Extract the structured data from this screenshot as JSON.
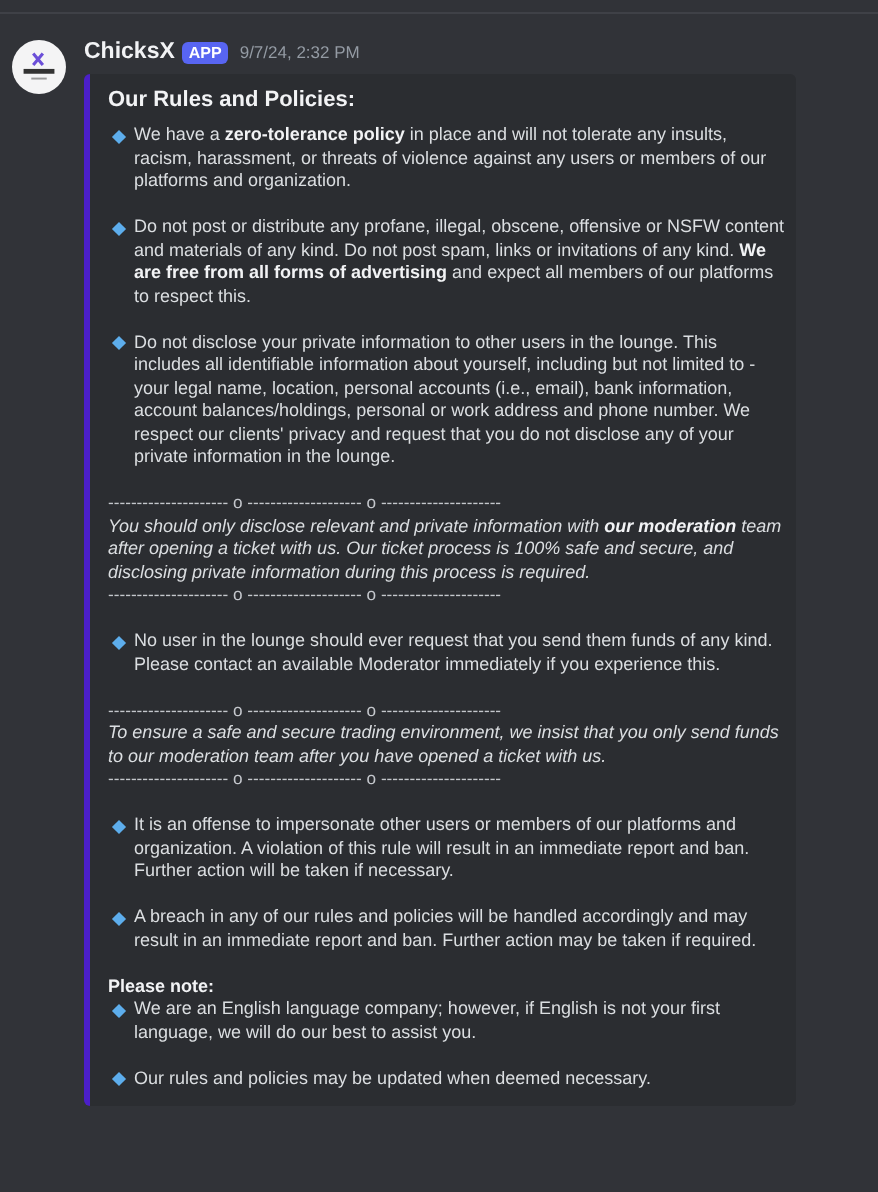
{
  "message": {
    "author": "ChicksX",
    "badge": "APP",
    "timestamp": "9/7/24, 2:32 PM"
  },
  "embed": {
    "color": "#4b1fc9",
    "blocks": [
      {
        "kind": "title",
        "spaced": false,
        "text": "Our Rules and Policies:"
      },
      {
        "kind": "bullet",
        "spaced": false,
        "text": "We have a **zero-tolerance policy** in place and will not tolerate any insults, racism, harassment, or threats of violence against any users or members of our platforms and organization."
      },
      {
        "kind": "bullet",
        "spaced": true,
        "text": "Do not post or distribute any profane, illegal, obscene, offensive or NSFW content and materials of any kind. Do not post spam, links or invitations of any kind. **We are free from all forms of advertising** and expect all members of our platforms to respect this."
      },
      {
        "kind": "bullet",
        "spaced": true,
        "text": "Do not disclose your private information to other users in the lounge. This includes all identifiable information about yourself, including but not limited to - your legal name, location, personal accounts (i.e., email), bank information, account balances/holdings, personal or work address and phone number. We respect our clients' privacy and request that you do not disclose any of your private information in the lounge."
      },
      {
        "kind": "rule",
        "spaced": true,
        "text": "--------------------- o -------------------- o ---------------------"
      },
      {
        "kind": "italic",
        "spaced": false,
        "text": "You should only disclose relevant and private information with **our moderation** team after opening a ticket with us. Our ticket process is 100% safe and secure, and disclosing private information during this process is required."
      },
      {
        "kind": "rule",
        "spaced": false,
        "text": "--------------------- o -------------------- o ---------------------"
      },
      {
        "kind": "bullet",
        "spaced": true,
        "text": "No user in the lounge should ever request that you send them funds of any kind. Please contact an available Moderator immediately if you experience this."
      },
      {
        "kind": "rule",
        "spaced": true,
        "text": "--------------------- o -------------------- o ---------------------"
      },
      {
        "kind": "italic",
        "spaced": false,
        "text": "To ensure a safe and secure trading environment, we insist that you only send funds to our moderation team after you have opened a ticket with us."
      },
      {
        "kind": "rule",
        "spaced": false,
        "text": "--------------------- o -------------------- o ---------------------"
      },
      {
        "kind": "bullet",
        "spaced": true,
        "text": "It is an offense to impersonate other users or members of our platforms and organization. A violation of this rule will result in an immediate report and ban. Further action will be taken if necessary."
      },
      {
        "kind": "bullet",
        "spaced": true,
        "text": "A breach in any of our rules and policies will be handled accordingly and may result in an immediate report and ban. Further action may be taken if required."
      },
      {
        "kind": "label",
        "spaced": true,
        "text": "Please note:"
      },
      {
        "kind": "bullet",
        "spaced": false,
        "text": "We are an English language company; however, if English is not your first language, we will do our best to assist you."
      },
      {
        "kind": "bullet",
        "spaced": true,
        "text": "Our rules and policies may be updated when deemed necessary."
      }
    ]
  }
}
